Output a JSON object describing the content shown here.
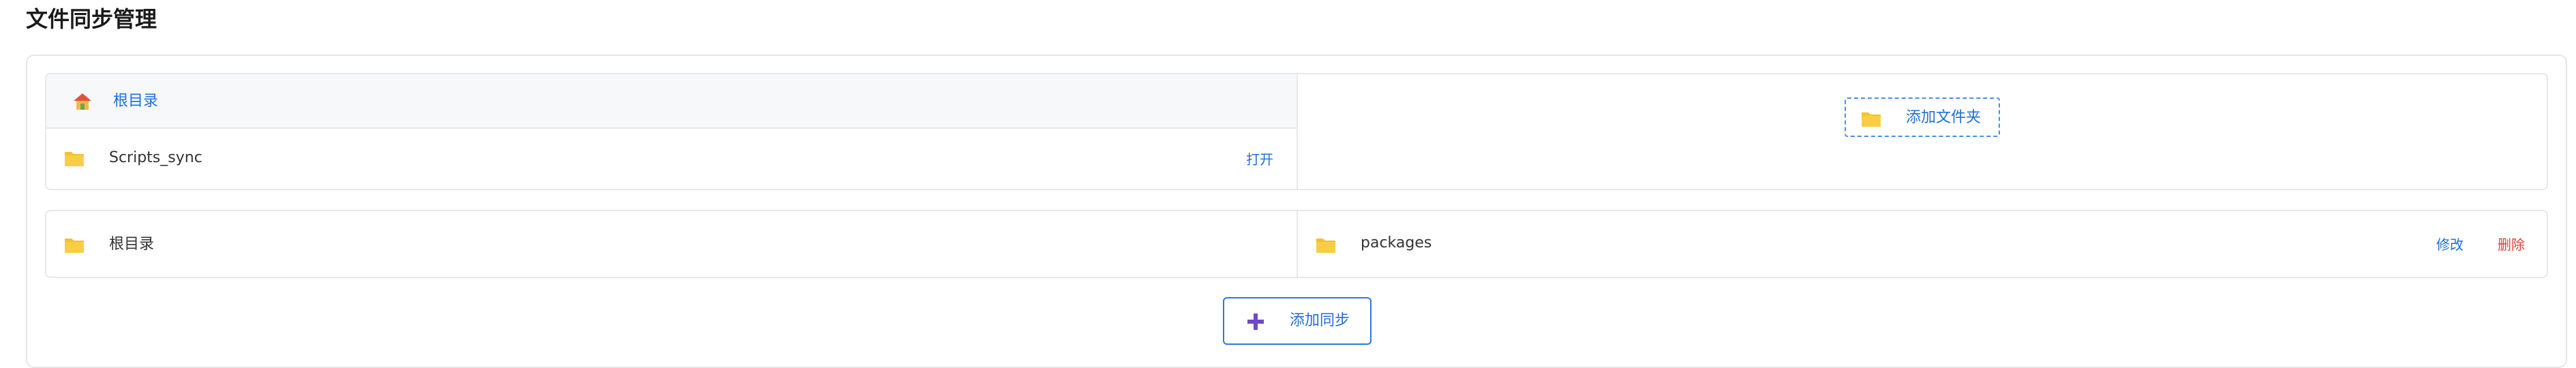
{
  "header": {
    "title": "文件同步管理"
  },
  "browser": {
    "breadcrumb": {
      "label": "根目录",
      "icon": "home-icon"
    },
    "folders": [
      {
        "name": "Scripts_sync",
        "action": "打开",
        "icon": "folder-icon"
      }
    ],
    "add_folder_label": "添加文件夹"
  },
  "sync_pairs": [
    {
      "source": "根目录",
      "target": "packages",
      "edit_label": "修改",
      "delete_label": "删除"
    }
  ],
  "add_sync_label": "添加同步",
  "colors": {
    "accent": "#1f6fd6",
    "danger": "#e0403a",
    "folder": "#f5c02e",
    "plus": "#6d4bc4"
  }
}
